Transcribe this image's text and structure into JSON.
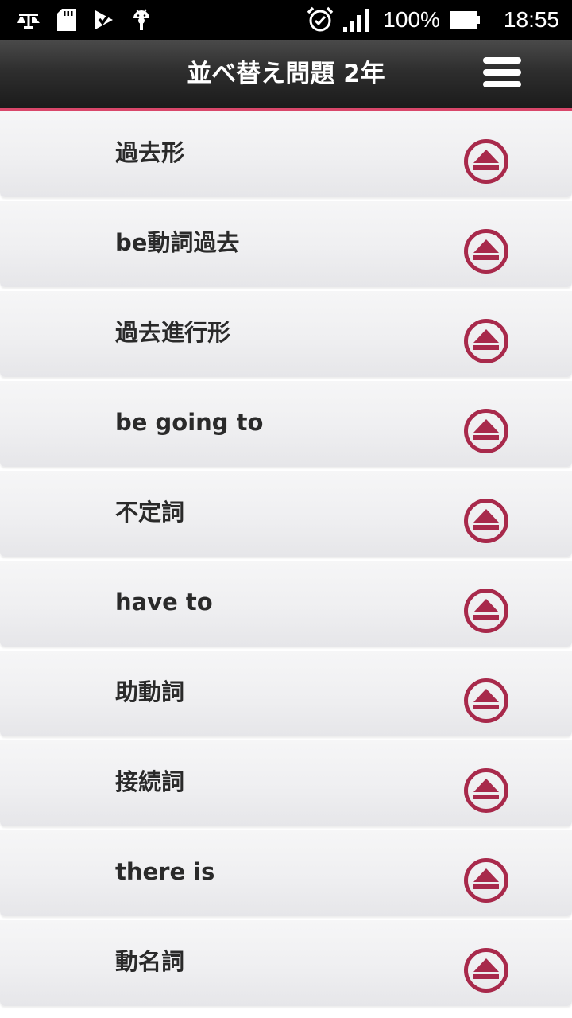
{
  "status_bar": {
    "battery": "100%",
    "time": "18:55",
    "icons": [
      "scale-icon",
      "sd-card-icon",
      "check-play-icon",
      "android-icon",
      "alarm-icon",
      "signal-icon",
      "battery-icon"
    ]
  },
  "header": {
    "title": "並べ替え問題 2年",
    "menu_icon": "hamburger-menu-icon"
  },
  "list": {
    "items": [
      {
        "label": "過去形",
        "icon": "eject-icon"
      },
      {
        "label": "be動詞過去",
        "icon": "eject-icon"
      },
      {
        "label": "過去進行形",
        "icon": "eject-icon"
      },
      {
        "label": "be going to",
        "icon": "eject-icon"
      },
      {
        "label": "不定詞",
        "icon": "eject-icon"
      },
      {
        "label": "have to",
        "icon": "eject-icon"
      },
      {
        "label": "助動詞",
        "icon": "eject-icon"
      },
      {
        "label": "接続詞",
        "icon": "eject-icon"
      },
      {
        "label": "there is",
        "icon": "eject-icon"
      },
      {
        "label": "動名詞",
        "icon": "eject-icon"
      }
    ]
  },
  "colors": {
    "accent": "#a8294b",
    "header_border": "#d9476a",
    "header_bg": "#2e2e2e",
    "item_text": "#2a2a2a"
  }
}
